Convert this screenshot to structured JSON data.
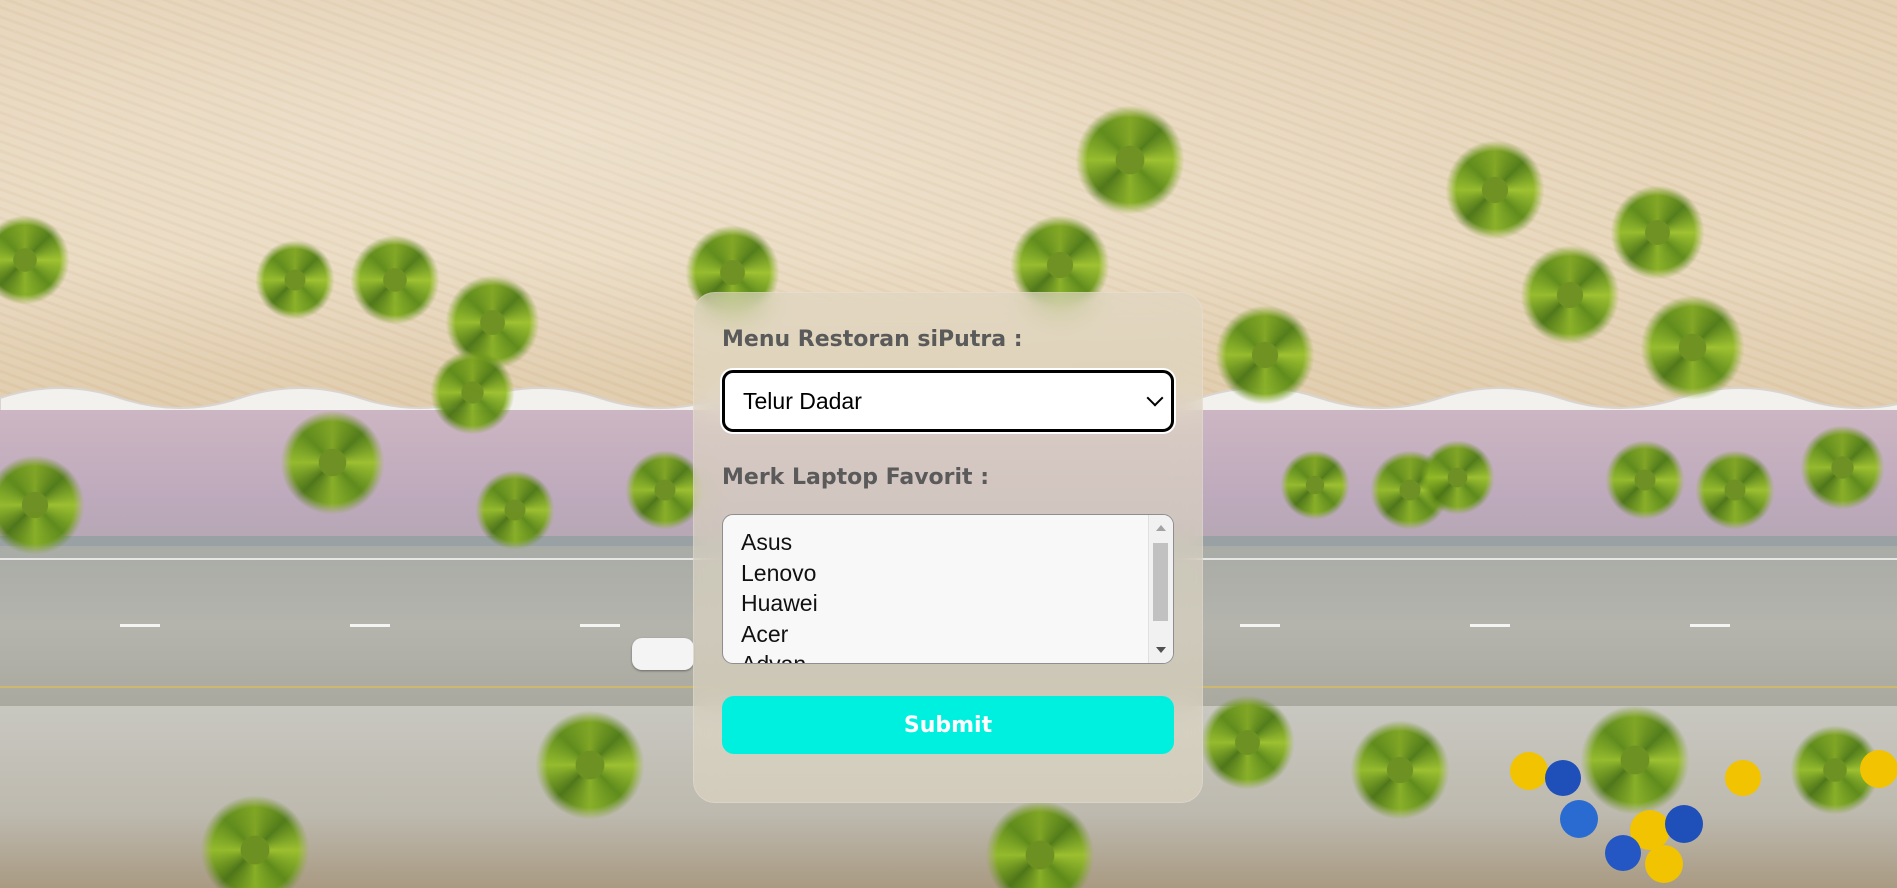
{
  "form": {
    "menu_label": "Menu Restoran siPutra :",
    "menu_selected": "Telur Dadar",
    "laptop_label": "Merk Laptop Favorit :",
    "laptop_options": [
      "Asus",
      "Lenovo",
      "Huawei",
      "Acer",
      "Advan"
    ],
    "submit_label": "Submit"
  },
  "colors": {
    "submit_bg": "#00f0e0",
    "label_text": "#5a5a5a"
  },
  "icons": {
    "select_arrow": "chevron-down-icon",
    "scroll_up": "scroll-up-arrow-icon",
    "scroll_down": "scroll-down-arrow-icon"
  }
}
